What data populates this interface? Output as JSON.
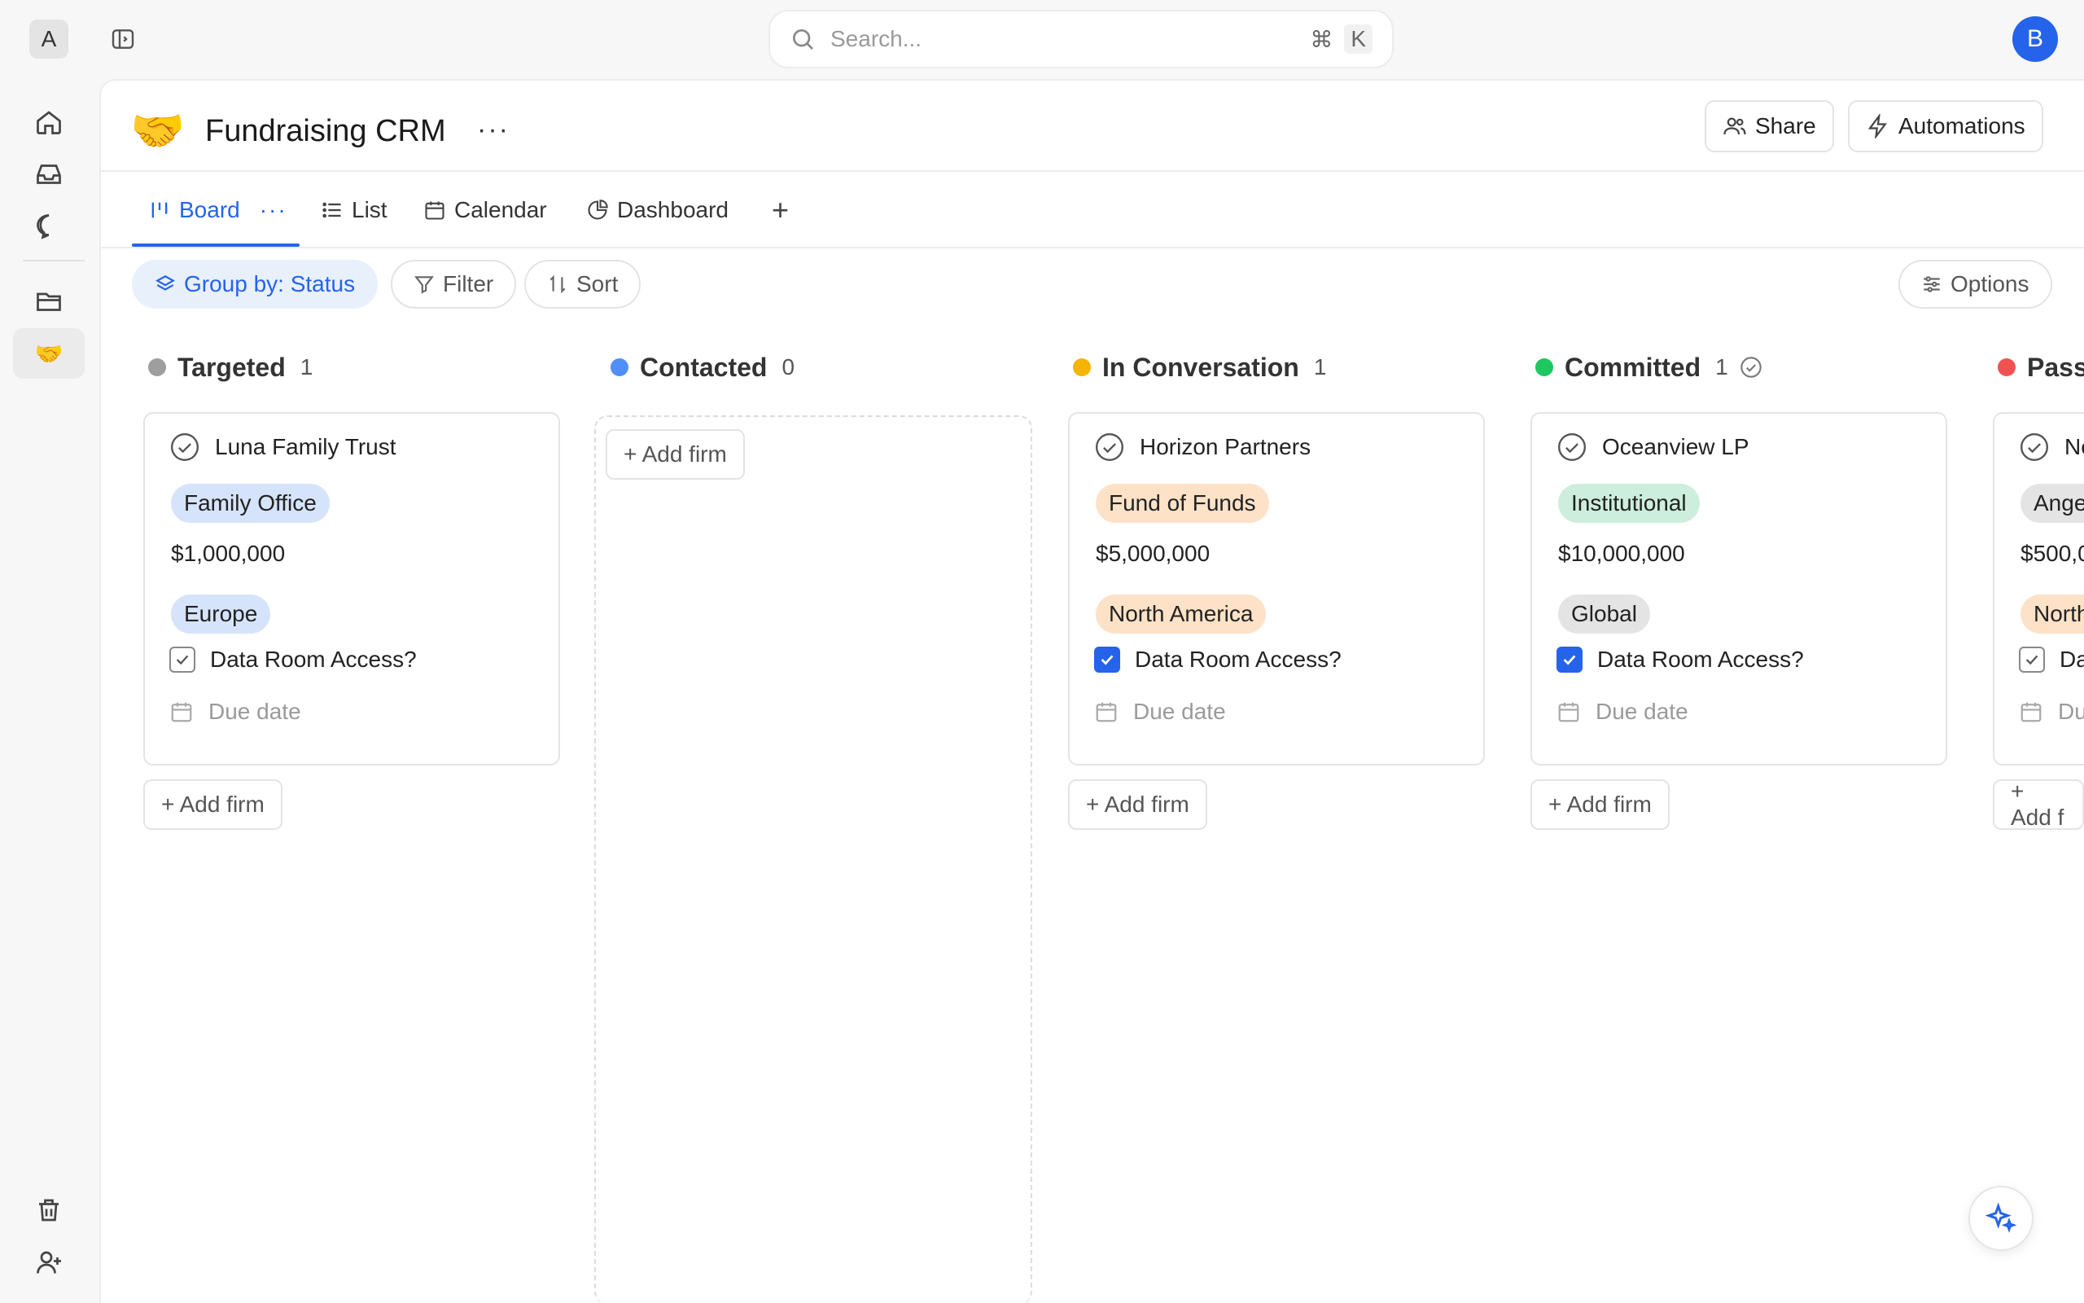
{
  "topbar": {
    "workspace_initial": "A",
    "search_placeholder": "Search...",
    "shortcut_cmd": "⌘",
    "shortcut_key": "K",
    "user_initial": "B"
  },
  "page": {
    "emoji": "🤝",
    "title": "Fundraising CRM",
    "more": "···",
    "share_label": "Share",
    "automations_label": "Automations"
  },
  "tabs": [
    {
      "label": "Board",
      "more": "···",
      "icon": "board-icon"
    },
    {
      "label": "List",
      "icon": "list-icon"
    },
    {
      "label": "Calendar",
      "icon": "calendar-icon"
    },
    {
      "label": "Dashboard",
      "icon": "pie-chart-icon"
    },
    {
      "label": "+",
      "icon": "plus-icon"
    }
  ],
  "toolbar": {
    "group_by": "Group by: Status",
    "filter": "Filter",
    "sort": "Sort",
    "options": "Options"
  },
  "columns": [
    {
      "name": "Targeted",
      "count": "1",
      "color": "#9e9e9e",
      "card": {
        "name": "Luna Family Trust",
        "type": "Family Office",
        "amount": "$1,000,000",
        "region": "Europe",
        "checkbox_label": "Data Room Access?",
        "checked": false,
        "due": "Due date"
      },
      "add": "+ Add firm"
    },
    {
      "name": "Contacted",
      "count": "0",
      "color": "#4f8ff7",
      "add": "+ Add firm"
    },
    {
      "name": "In Conversation",
      "count": "1",
      "color": "#f5b400",
      "card": {
        "name": "Horizon Partners",
        "type": "Fund of Funds",
        "amount": "$5,000,000",
        "region": "North America",
        "checkbox_label": "Data Room Access?",
        "checked": true,
        "due": "Due date"
      },
      "add": "+ Add firm"
    },
    {
      "name": "Committed",
      "count": "1",
      "color": "#1ec760",
      "card": {
        "name": "Oceanview LP",
        "type": "Institutional",
        "amount": "$10,000,000",
        "region": "Global",
        "checkbox_label": "Data Room Access?",
        "checked": true,
        "due": "Due date"
      },
      "add": "+ Add firm"
    },
    {
      "name": "Pass",
      "count": "",
      "color": "#f05252",
      "card": {
        "name": "Ne",
        "type": "Ange",
        "amount": "$500,0",
        "region": "North",
        "checkbox_label": "Da",
        "checked": false,
        "due": "Du"
      },
      "add": "+ Add f"
    }
  ],
  "tag_colors": {
    "family_office": "#d6e4fb",
    "europe": "#d6e4fb",
    "fund_of_funds": "#fde2c8",
    "north_america": "#fde2c8",
    "institutional": "#cdeedd",
    "global": "#e4e4e4",
    "angel": "#e4e4e4"
  }
}
